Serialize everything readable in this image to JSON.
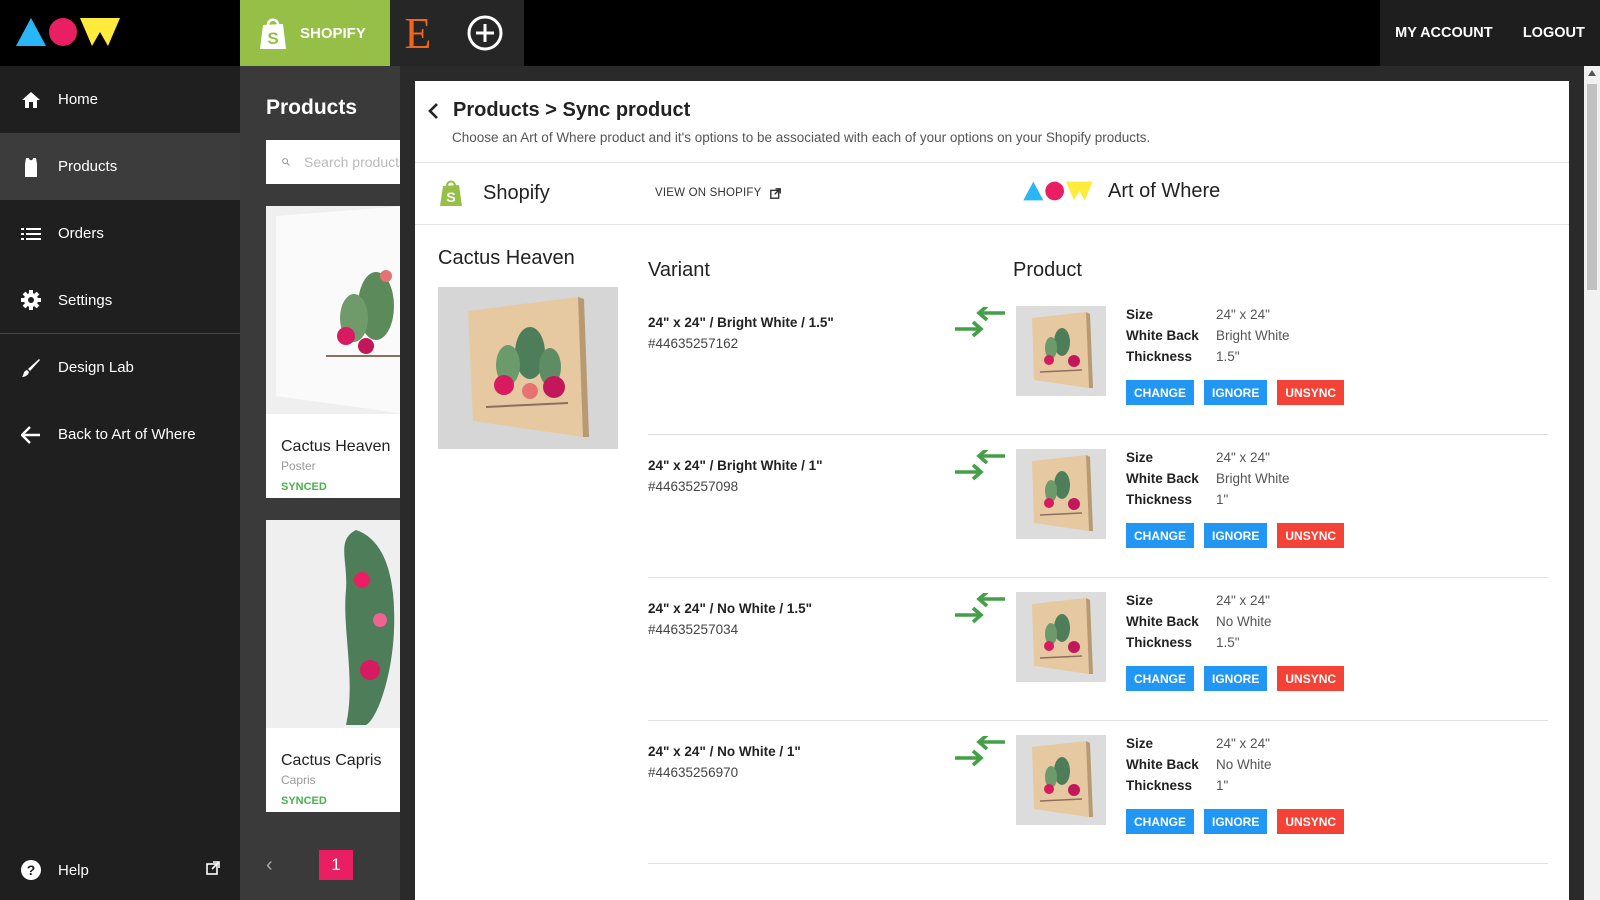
{
  "topbar": {
    "shopify_label": "SHOPIFY",
    "etsy_glyph": "E",
    "my_account": "MY ACCOUNT",
    "logout": "LOGOUT"
  },
  "sidebar": {
    "items": [
      {
        "label": "Home",
        "icon": "home-icon"
      },
      {
        "label": "Products",
        "icon": "tshirt-icon"
      },
      {
        "label": "Orders",
        "icon": "list-icon"
      },
      {
        "label": "Settings",
        "icon": "gear-icon"
      },
      {
        "label": "Design Lab",
        "icon": "brush-icon"
      },
      {
        "label": "Back to Art of Where",
        "icon": "arrow-left-icon"
      }
    ],
    "help": "Help"
  },
  "products_list": {
    "title": "Products",
    "search_placeholder": "Search products",
    "cards": [
      {
        "name": "Cactus Heaven",
        "type": "Poster",
        "status": "SYNCED"
      },
      {
        "name": "Cactus Capris",
        "type": "Capris",
        "status": "SYNCED"
      }
    ],
    "page": "1"
  },
  "modal": {
    "title": "Products > Sync product",
    "subtitle": "Choose an Art of Where product and it's options to be associated with each of your options on your Shopify products.",
    "shopify_name": "Shopify",
    "view_on_shopify": "VIEW ON SHOPIFY",
    "aow_name": "Art of Where",
    "product_name": "Cactus Heaven",
    "col_variant": "Variant",
    "col_product": "Product",
    "attr_labels": {
      "size": "Size",
      "white_back": "White Back",
      "thickness": "Thickness"
    },
    "buttons": {
      "change": "CHANGE",
      "ignore": "IGNORE",
      "unsync": "UNSYNC"
    },
    "rows": [
      {
        "variant": "24\" x 24\" / Bright White / 1.5\"",
        "id": "#44635257162",
        "size": "24\" x 24\"",
        "white_back": "Bright White",
        "thickness": "1.5\""
      },
      {
        "variant": "24\" x 24\" / Bright White / 1\"",
        "id": "#44635257098",
        "size": "24\" x 24\"",
        "white_back": "Bright White",
        "thickness": "1\""
      },
      {
        "variant": "24\" x 24\" / No White / 1.5\"",
        "id": "#44635257034",
        "size": "24\" x 24\"",
        "white_back": "No White",
        "thickness": "1.5\""
      },
      {
        "variant": "24\" x 24\" / No White / 1\"",
        "id": "#44635256970",
        "size": "24\" x 24\"",
        "white_back": "No White",
        "thickness": "1\""
      }
    ]
  },
  "colors": {
    "shopify_green": "#95bf47",
    "aow_cyan": "#29b6f6",
    "aow_magenta": "#e91e63",
    "aow_yellow": "#ffeb3b",
    "sync_green": "#4caf50",
    "button_blue": "#2196f3",
    "button_red": "#f44336"
  }
}
